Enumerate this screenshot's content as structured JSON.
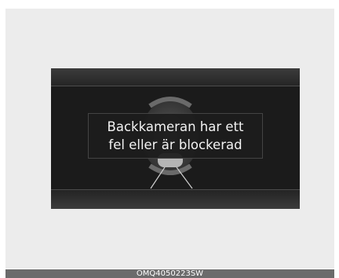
{
  "screen": {
    "message": {
      "line1": "Backkameran har ett",
      "line2": "fel eller är blockerad"
    },
    "graphic": {
      "icon": "rear-camera-guide-icon"
    }
  },
  "caption": {
    "code": "OMQ4050223SW"
  },
  "colors": {
    "panel_background": "#ececec",
    "screen_background": "#1b1b1b",
    "message_text": "#f2f2f2",
    "caption_bar": "#6b6b6b"
  }
}
